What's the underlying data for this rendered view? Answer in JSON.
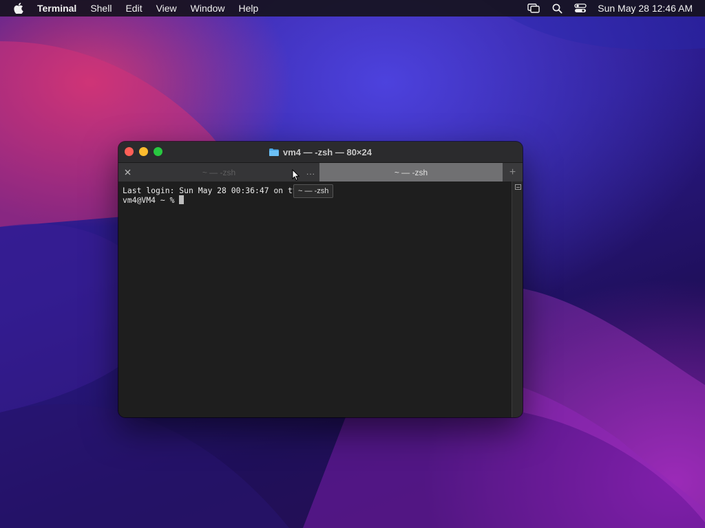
{
  "menubar": {
    "app_name": "Terminal",
    "items": [
      "Shell",
      "Edit",
      "View",
      "Window",
      "Help"
    ],
    "clock": "Sun May 28  12:46 AM",
    "icons": [
      "apple-icon",
      "screen-mirroring-icon",
      "search-icon",
      "control-center-icon"
    ]
  },
  "window": {
    "title": "vm4 — -zsh — 80×24",
    "tabs": [
      {
        "label": "~ — -zsh",
        "active": false
      },
      {
        "label": "~ — -zsh",
        "active": true
      }
    ],
    "new_tab_label": "+",
    "overflow_label": "...",
    "tooltip": "~ — -zsh",
    "terminal_lines": [
      "Last login: Sun May 28 00:36:47 on ttys000",
      "vm4@VM4 ~ % "
    ]
  },
  "colors": {
    "close": "#fe5f57",
    "minimize": "#febc2e",
    "maximize": "#28c840",
    "terminal_bg": "#1e1e1e",
    "active_tab": "#707072"
  }
}
